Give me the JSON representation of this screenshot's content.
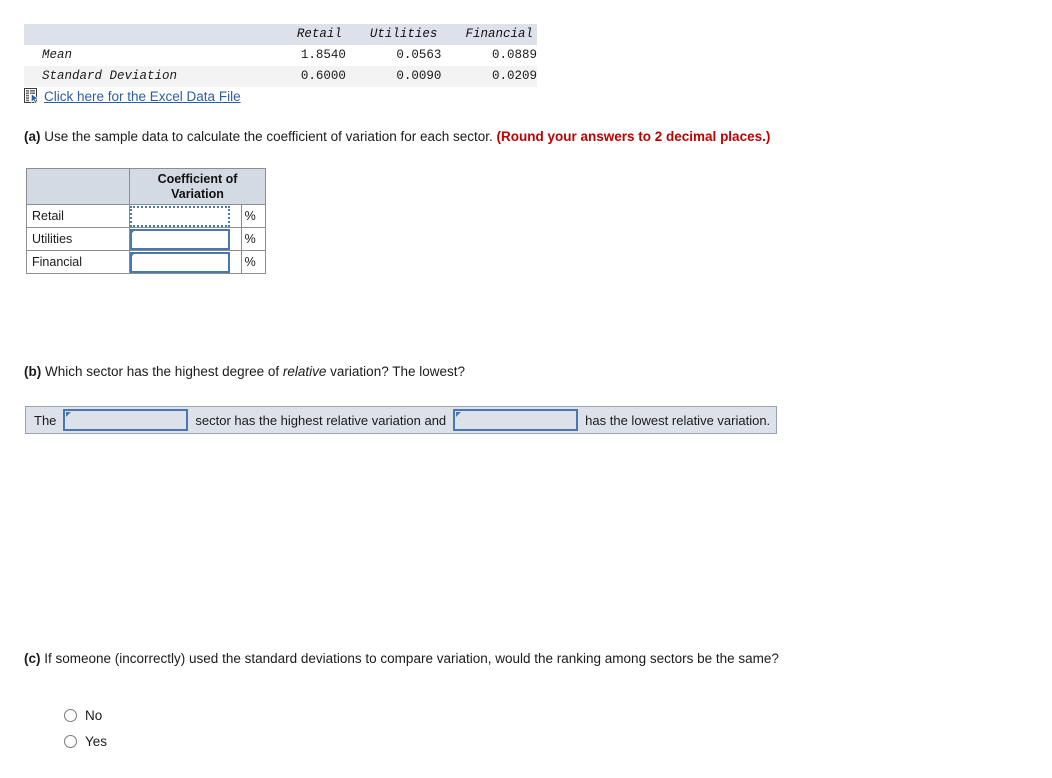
{
  "stats_table": {
    "columns": [
      "",
      "Retail",
      "Utilities",
      "Financial"
    ],
    "rows": [
      {
        "label": "Mean",
        "values": [
          "1.8540",
          "0.0563",
          "0.0889"
        ]
      },
      {
        "label": "Standard Deviation",
        "values": [
          "0.6000",
          "0.0090",
          "0.0209"
        ]
      }
    ]
  },
  "excel_link": {
    "icon": "spreadsheet-icon",
    "label": "Click here for the Excel Data File"
  },
  "questions": {
    "a": {
      "marker": "(a)",
      "text": " Use the sample data to calculate the coefficient of variation for each sector. ",
      "note": "(Round your answers to 2 decimal places.)"
    },
    "b": {
      "marker": "(b)",
      "text_before": " Which sector has the highest degree of ",
      "italic": "relative",
      "text_after": " variation? The lowest?"
    },
    "c": {
      "marker": "(c)",
      "text": " If someone (incorrectly) used the standard deviations to compare variation, would the ranking among sectors be the same?"
    }
  },
  "cv_table": {
    "corner_header": "",
    "value_header": "Coefficient of Variation",
    "percent_symbol": "%",
    "rows": [
      {
        "label": "Retail",
        "value": "",
        "focused": true
      },
      {
        "label": "Utilities",
        "value": "",
        "focused": false
      },
      {
        "label": "Financial",
        "value": "",
        "focused": false
      }
    ]
  },
  "sentence_b": {
    "prefix": "The",
    "dropdown_1_value": "",
    "middle": "sector has the highest relative variation and",
    "dropdown_2_value": "",
    "suffix": "has the lowest relative variation."
  },
  "radio_options": [
    {
      "label": "No",
      "selected": false
    },
    {
      "label": "Yes",
      "selected": false
    }
  ],
  "colors": {
    "link": "#2b5ca8",
    "note_red": "#c00000",
    "header_blue_gray": "#dde2ea",
    "table_header": "#d4dae4",
    "input_border": "#4a77ad"
  }
}
